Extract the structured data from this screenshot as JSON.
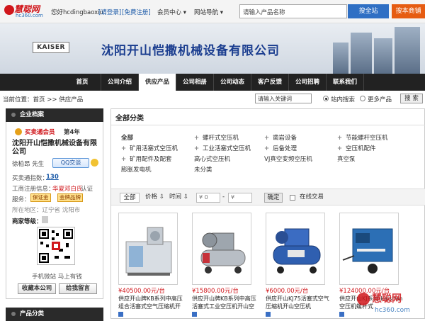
{
  "topbar": {
    "logo_main": "慧聪网",
    "logo_sub": "hc360.com",
    "greeting": "您好hcdingbaoxiu",
    "login": "[请登录]",
    "register": "[免费注册]",
    "member_center": "会员中心",
    "site_nav": "网站导航",
    "search_placeholder": "请输入产品名称",
    "search_btn": "搜全站",
    "search_local_btn": "搜本商铺"
  },
  "banner": {
    "brand": "KAISER",
    "company": "沈阳开山恺撒机械设备有限公司"
  },
  "nav": {
    "items": [
      "首页",
      "公司介绍",
      "供应产品",
      "公司相册",
      "公司动态",
      "客户反馈",
      "公司招聘",
      "联系我们"
    ],
    "active_index": 2
  },
  "crumb": {
    "label": "当前位置：",
    "home": "首页",
    "sep": ">>",
    "current": "供应产品",
    "search_placeholder": "请输入关键词",
    "radio1": "站内搜索",
    "radio2": "更多产品",
    "search_btn": "搜 索"
  },
  "sidebar": {
    "header": "企业档案",
    "member_label": "买卖通会员",
    "years": "第4年",
    "company": "沈阳开山恺撒机械设备有限公司",
    "contact": "徐柏昂  先生",
    "qq_label": "QQ交谈",
    "inquiry_label": "买卖通指数：",
    "inquiry_value": "130",
    "reg_label": "工商注册信息：",
    "reg_value": "华夏邓白氏",
    "reg_tail": "认证",
    "service_label": "服务：",
    "service_badges": [
      "保证金",
      "金牌品牌"
    ],
    "location": "所在地区：辽宁省  沈阳市",
    "level_label": "商家等级：",
    "mobile_label": "手机微站 马上有钱",
    "btn_collect": "收藏本公司",
    "btn_message": "给我留言",
    "footer_header": "产品分类"
  },
  "main": {
    "title": "全部分类",
    "categories": [
      {
        "label": "全部",
        "bold": true,
        "plus": false
      },
      {
        "label": "螺杆式空压机",
        "plus": true
      },
      {
        "label": "凿岩设备",
        "plus": true
      },
      {
        "label": "节能螺杆空压机",
        "plus": true
      },
      {
        "label": "矿用活塞式空压机",
        "plus": true
      },
      {
        "label": "工业活塞式空压机",
        "plus": true
      },
      {
        "label": "后备处理",
        "plus": true
      },
      {
        "label": "空压机配件",
        "plus": true
      },
      {
        "label": "矿用配件及配套",
        "plus": true
      },
      {
        "label": "高心式空压机",
        "plus": false
      },
      {
        "label": "VJ真空变频空压机",
        "plus": false
      },
      {
        "label": "真空泵",
        "plus": false
      },
      {
        "label": "膨胀发电机",
        "plus": false
      },
      {
        "label": "未分类",
        "plus": false
      }
    ],
    "filter": {
      "all": "全部",
      "price": "价格",
      "time": "时间",
      "price_from": "¥ 0",
      "price_to": "¥",
      "ok": "确定",
      "in_stock": "在线交易"
    },
    "products": [
      {
        "price": "¥40500.00元/台",
        "name": "供应开山牌KB系列中高压组合活塞式空气压缩机开山空",
        "color": "#3f8fd1"
      },
      {
        "price": "¥15800.00元/台",
        "name": "供应开山牌KB系列中高压活塞式工业空压机开山空压机",
        "color": "#c7323a"
      },
      {
        "price": "¥6000.00元/台",
        "name": "供应开山KJ75活塞式空气压缩机开山空压机",
        "color": "#2f5fb0"
      },
      {
        "price": "¥124000.00元/台",
        "name": "供应开山KJ系列-kaishan空压机螺杆式",
        "color": "#2c6fb5"
      }
    ]
  },
  "watermark": {
    "text": "慧聪网",
    "sub": "hc360.com"
  }
}
